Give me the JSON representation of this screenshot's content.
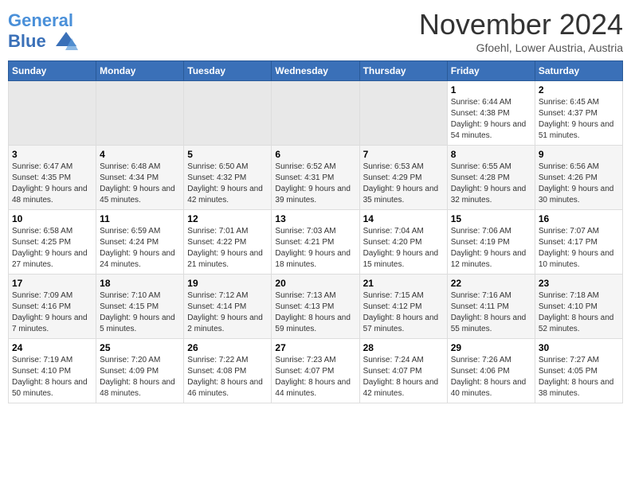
{
  "header": {
    "logo_line1": "General",
    "logo_line2": "Blue",
    "month": "November 2024",
    "location": "Gfoehl, Lower Austria, Austria"
  },
  "weekdays": [
    "Sunday",
    "Monday",
    "Tuesday",
    "Wednesday",
    "Thursday",
    "Friday",
    "Saturday"
  ],
  "weeks": [
    [
      {
        "day": "",
        "info": ""
      },
      {
        "day": "",
        "info": ""
      },
      {
        "day": "",
        "info": ""
      },
      {
        "day": "",
        "info": ""
      },
      {
        "day": "",
        "info": ""
      },
      {
        "day": "1",
        "info": "Sunrise: 6:44 AM\nSunset: 4:38 PM\nDaylight: 9 hours and 54 minutes."
      },
      {
        "day": "2",
        "info": "Sunrise: 6:45 AM\nSunset: 4:37 PM\nDaylight: 9 hours and 51 minutes."
      }
    ],
    [
      {
        "day": "3",
        "info": "Sunrise: 6:47 AM\nSunset: 4:35 PM\nDaylight: 9 hours and 48 minutes."
      },
      {
        "day": "4",
        "info": "Sunrise: 6:48 AM\nSunset: 4:34 PM\nDaylight: 9 hours and 45 minutes."
      },
      {
        "day": "5",
        "info": "Sunrise: 6:50 AM\nSunset: 4:32 PM\nDaylight: 9 hours and 42 minutes."
      },
      {
        "day": "6",
        "info": "Sunrise: 6:52 AM\nSunset: 4:31 PM\nDaylight: 9 hours and 39 minutes."
      },
      {
        "day": "7",
        "info": "Sunrise: 6:53 AM\nSunset: 4:29 PM\nDaylight: 9 hours and 35 minutes."
      },
      {
        "day": "8",
        "info": "Sunrise: 6:55 AM\nSunset: 4:28 PM\nDaylight: 9 hours and 32 minutes."
      },
      {
        "day": "9",
        "info": "Sunrise: 6:56 AM\nSunset: 4:26 PM\nDaylight: 9 hours and 30 minutes."
      }
    ],
    [
      {
        "day": "10",
        "info": "Sunrise: 6:58 AM\nSunset: 4:25 PM\nDaylight: 9 hours and 27 minutes."
      },
      {
        "day": "11",
        "info": "Sunrise: 6:59 AM\nSunset: 4:24 PM\nDaylight: 9 hours and 24 minutes."
      },
      {
        "day": "12",
        "info": "Sunrise: 7:01 AM\nSunset: 4:22 PM\nDaylight: 9 hours and 21 minutes."
      },
      {
        "day": "13",
        "info": "Sunrise: 7:03 AM\nSunset: 4:21 PM\nDaylight: 9 hours and 18 minutes."
      },
      {
        "day": "14",
        "info": "Sunrise: 7:04 AM\nSunset: 4:20 PM\nDaylight: 9 hours and 15 minutes."
      },
      {
        "day": "15",
        "info": "Sunrise: 7:06 AM\nSunset: 4:19 PM\nDaylight: 9 hours and 12 minutes."
      },
      {
        "day": "16",
        "info": "Sunrise: 7:07 AM\nSunset: 4:17 PM\nDaylight: 9 hours and 10 minutes."
      }
    ],
    [
      {
        "day": "17",
        "info": "Sunrise: 7:09 AM\nSunset: 4:16 PM\nDaylight: 9 hours and 7 minutes."
      },
      {
        "day": "18",
        "info": "Sunrise: 7:10 AM\nSunset: 4:15 PM\nDaylight: 9 hours and 5 minutes."
      },
      {
        "day": "19",
        "info": "Sunrise: 7:12 AM\nSunset: 4:14 PM\nDaylight: 9 hours and 2 minutes."
      },
      {
        "day": "20",
        "info": "Sunrise: 7:13 AM\nSunset: 4:13 PM\nDaylight: 8 hours and 59 minutes."
      },
      {
        "day": "21",
        "info": "Sunrise: 7:15 AM\nSunset: 4:12 PM\nDaylight: 8 hours and 57 minutes."
      },
      {
        "day": "22",
        "info": "Sunrise: 7:16 AM\nSunset: 4:11 PM\nDaylight: 8 hours and 55 minutes."
      },
      {
        "day": "23",
        "info": "Sunrise: 7:18 AM\nSunset: 4:10 PM\nDaylight: 8 hours and 52 minutes."
      }
    ],
    [
      {
        "day": "24",
        "info": "Sunrise: 7:19 AM\nSunset: 4:10 PM\nDaylight: 8 hours and 50 minutes."
      },
      {
        "day": "25",
        "info": "Sunrise: 7:20 AM\nSunset: 4:09 PM\nDaylight: 8 hours and 48 minutes."
      },
      {
        "day": "26",
        "info": "Sunrise: 7:22 AM\nSunset: 4:08 PM\nDaylight: 8 hours and 46 minutes."
      },
      {
        "day": "27",
        "info": "Sunrise: 7:23 AM\nSunset: 4:07 PM\nDaylight: 8 hours and 44 minutes."
      },
      {
        "day": "28",
        "info": "Sunrise: 7:24 AM\nSunset: 4:07 PM\nDaylight: 8 hours and 42 minutes."
      },
      {
        "day": "29",
        "info": "Sunrise: 7:26 AM\nSunset: 4:06 PM\nDaylight: 8 hours and 40 minutes."
      },
      {
        "day": "30",
        "info": "Sunrise: 7:27 AM\nSunset: 4:05 PM\nDaylight: 8 hours and 38 minutes."
      }
    ]
  ]
}
